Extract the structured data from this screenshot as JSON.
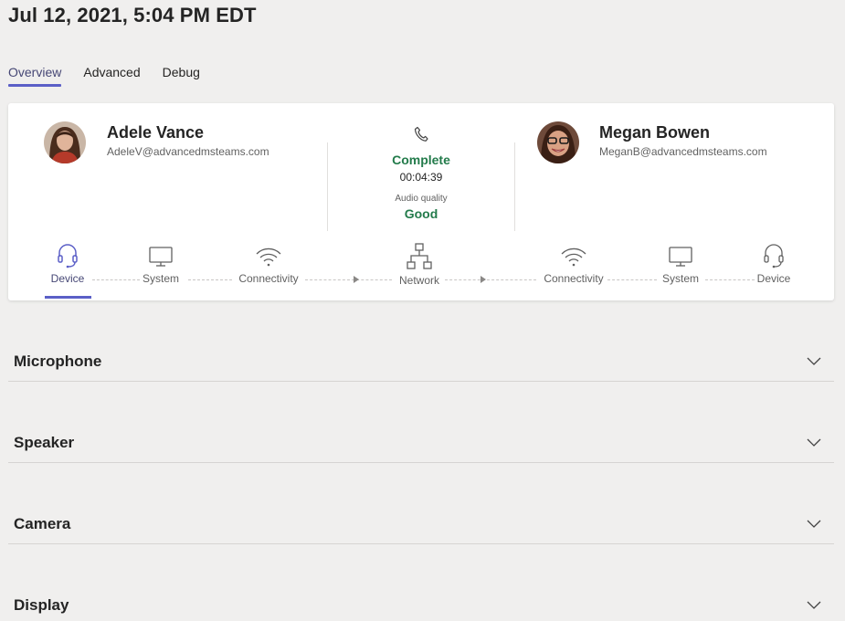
{
  "header": {
    "title": "Jul 12, 2021, 5:04 PM EDT"
  },
  "tabs": [
    {
      "label": "Overview",
      "active": true
    },
    {
      "label": "Advanced",
      "active": false
    },
    {
      "label": "Debug",
      "active": false
    }
  ],
  "call": {
    "caller": {
      "name": "Adele Vance",
      "email": "AdeleV@advancedmsteams.com"
    },
    "callee": {
      "name": "Megan Bowen",
      "email": "MeganB@advancedmsteams.com"
    },
    "status": "Complete",
    "duration": "00:04:39",
    "audio_quality_label": "Audio quality",
    "audio_quality_value": "Good",
    "status_color": "#237b4b"
  },
  "path": [
    {
      "label": "Device",
      "icon": "headset-icon",
      "active": true
    },
    {
      "label": "System",
      "icon": "monitor-icon"
    },
    {
      "label": "Connectivity",
      "icon": "wifi-icon"
    },
    {
      "label": "Network",
      "icon": "network-icon"
    },
    {
      "label": "Connectivity",
      "icon": "wifi-icon"
    },
    {
      "label": "System",
      "icon": "monitor-icon"
    },
    {
      "label": "Device",
      "icon": "headset-icon"
    }
  ],
  "sections": [
    {
      "label": "Microphone"
    },
    {
      "label": "Speaker"
    },
    {
      "label": "Camera"
    },
    {
      "label": "Display"
    }
  ],
  "colors": {
    "accent": "#5b5fc7",
    "background": "#f0efee"
  }
}
